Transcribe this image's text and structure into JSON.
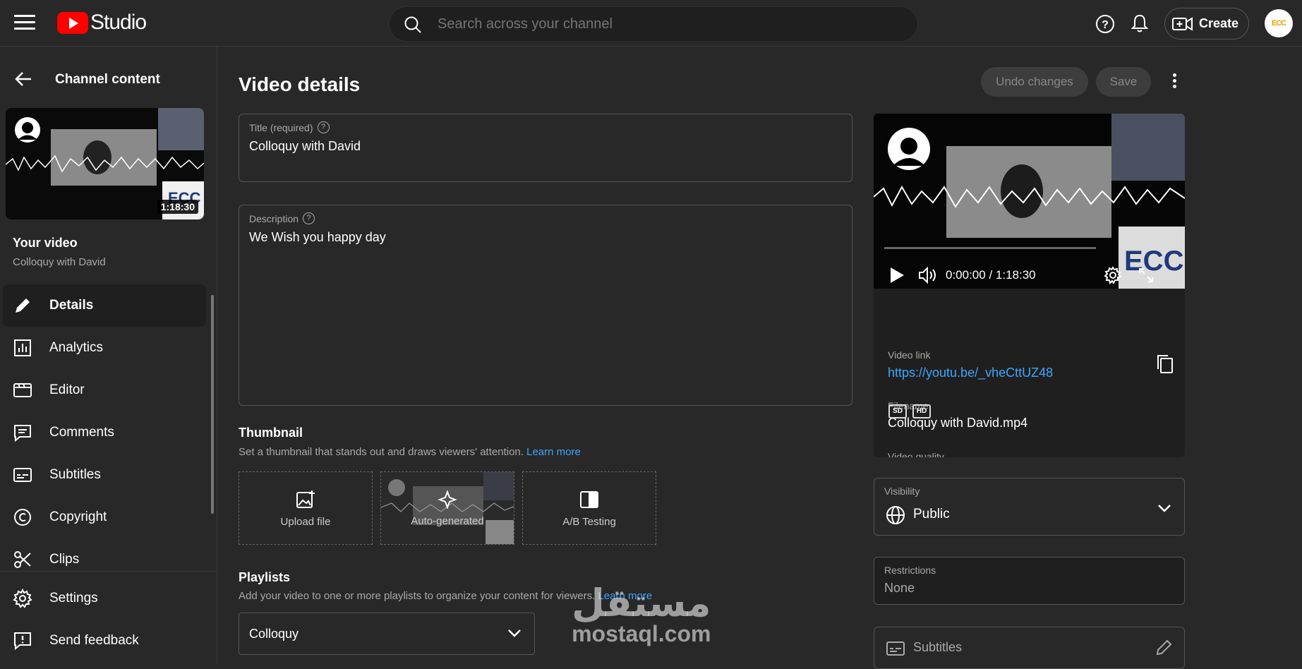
{
  "header": {
    "logo_text": "Studio",
    "search_placeholder": "Search across your channel",
    "create_label": "Create",
    "avatar_text": "ECC"
  },
  "sidebar": {
    "title": "Channel content",
    "duration": "1:18:30",
    "your_video_label": "Your video",
    "video_name": "Colloquy with David",
    "items": [
      {
        "label": "Details",
        "icon": "pencil-icon"
      },
      {
        "label": "Analytics",
        "icon": "analytics-icon"
      },
      {
        "label": "Editor",
        "icon": "editor-icon"
      },
      {
        "label": "Comments",
        "icon": "comments-icon"
      },
      {
        "label": "Subtitles",
        "icon": "subtitles-icon"
      },
      {
        "label": "Copyright",
        "icon": "copyright-icon"
      },
      {
        "label": "Clips",
        "icon": "scissors-icon"
      }
    ],
    "bottom_items": [
      {
        "label": "Settings",
        "icon": "gear-icon"
      },
      {
        "label": "Send feedback",
        "icon": "feedback-icon"
      }
    ]
  },
  "main": {
    "page_title": "Video details",
    "undo_label": "Undo changes",
    "save_label": "Save",
    "title_field": {
      "label": "Title (required)",
      "value": "Colloquy with David"
    },
    "description_field": {
      "label": "Description",
      "value": "We Wish you happy day"
    },
    "thumbnail": {
      "title": "Thumbnail",
      "desc": "Set a thumbnail that stands out and draws viewers' attention.",
      "learn_more": "Learn more",
      "options": [
        "Upload file",
        "Auto-generated",
        "A/B Testing"
      ]
    },
    "playlists": {
      "title": "Playlists",
      "desc": "Add your video to one or more playlists to organize your content for viewers.",
      "learn_more": "Learn more",
      "selected": "Colloquy"
    }
  },
  "preview": {
    "time": "0:00:00 / 1:18:30",
    "video_link_label": "Video link",
    "video_link": "https://youtu.be/_vheCttUZ48",
    "filename_label": "Filename",
    "filename": "Colloquy with David.mp4",
    "quality_label": "Video quality",
    "qualities": [
      "SD",
      "HD"
    ]
  },
  "visibility": {
    "label": "Visibility",
    "value": "Public"
  },
  "restrictions": {
    "label": "Restrictions",
    "value": "None"
  },
  "subtitles_card": {
    "label": "Subtitles"
  },
  "watermark": {
    "arabic": "مستقل",
    "latin": "mostaql.com"
  },
  "colors": {
    "accent_link": "#3ea6ff",
    "brand_red": "#ff0000",
    "bg": "#282828"
  }
}
